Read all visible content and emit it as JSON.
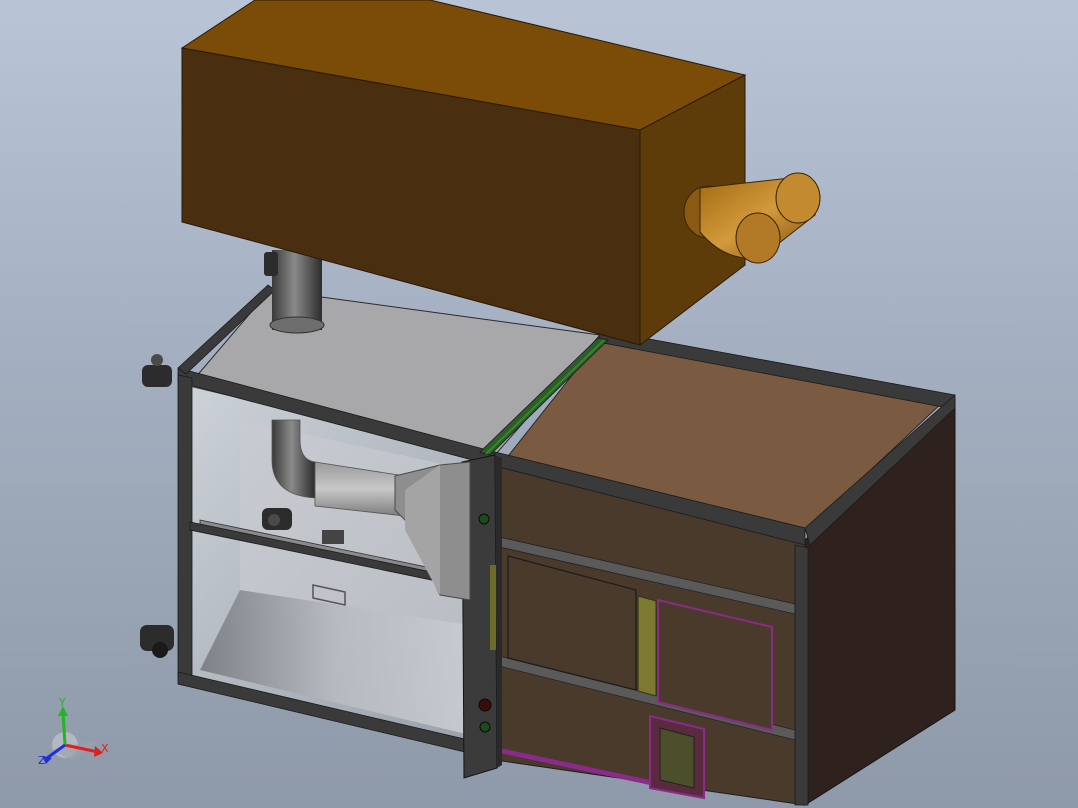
{
  "viewport": {
    "background_top": "#b9c5d6",
    "background_bottom": "#8e99a9"
  },
  "model": {
    "hood_color": "#6e4508",
    "frame_color": "#3a3a3a",
    "panel_color": "#4a3a2b",
    "side_panel_color": "#2e211e",
    "top_panel_color": "#7a5a40",
    "glass_tint": "#c4c8cf",
    "accent_colors": [
      "#2f8a2a",
      "#8a2a8a",
      "#7b7a30"
    ]
  },
  "triad": {
    "x_label": "X",
    "y_label": "Y",
    "z_label": "Z",
    "x_color": "#e0201c",
    "y_color": "#23b523",
    "z_color": "#2030d8"
  }
}
